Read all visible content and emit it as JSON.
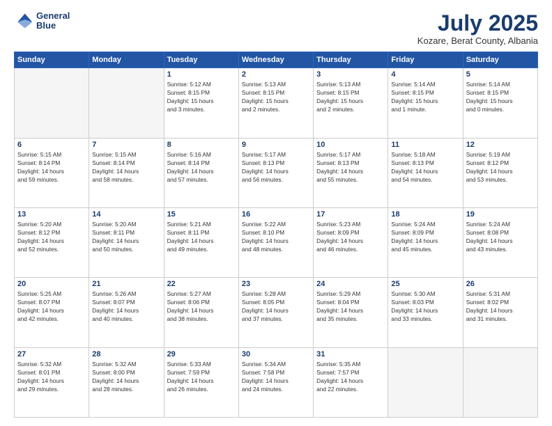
{
  "logo": {
    "line1": "General",
    "line2": "Blue"
  },
  "header": {
    "month": "July 2025",
    "location": "Kozare, Berat County, Albania"
  },
  "days_of_week": [
    "Sunday",
    "Monday",
    "Tuesday",
    "Wednesday",
    "Thursday",
    "Friday",
    "Saturday"
  ],
  "weeks": [
    [
      {
        "day": "",
        "info": ""
      },
      {
        "day": "",
        "info": ""
      },
      {
        "day": "1",
        "info": "Sunrise: 5:12 AM\nSunset: 8:15 PM\nDaylight: 15 hours\nand 3 minutes."
      },
      {
        "day": "2",
        "info": "Sunrise: 5:13 AM\nSunset: 8:15 PM\nDaylight: 15 hours\nand 2 minutes."
      },
      {
        "day": "3",
        "info": "Sunrise: 5:13 AM\nSunset: 8:15 PM\nDaylight: 15 hours\nand 2 minutes."
      },
      {
        "day": "4",
        "info": "Sunrise: 5:14 AM\nSunset: 8:15 PM\nDaylight: 15 hours\nand 1 minute."
      },
      {
        "day": "5",
        "info": "Sunrise: 5:14 AM\nSunset: 8:15 PM\nDaylight: 15 hours\nand 0 minutes."
      }
    ],
    [
      {
        "day": "6",
        "info": "Sunrise: 5:15 AM\nSunset: 8:14 PM\nDaylight: 14 hours\nand 59 minutes."
      },
      {
        "day": "7",
        "info": "Sunrise: 5:15 AM\nSunset: 8:14 PM\nDaylight: 14 hours\nand 58 minutes."
      },
      {
        "day": "8",
        "info": "Sunrise: 5:16 AM\nSunset: 8:14 PM\nDaylight: 14 hours\nand 57 minutes."
      },
      {
        "day": "9",
        "info": "Sunrise: 5:17 AM\nSunset: 8:13 PM\nDaylight: 14 hours\nand 56 minutes."
      },
      {
        "day": "10",
        "info": "Sunrise: 5:17 AM\nSunset: 8:13 PM\nDaylight: 14 hours\nand 55 minutes."
      },
      {
        "day": "11",
        "info": "Sunrise: 5:18 AM\nSunset: 8:13 PM\nDaylight: 14 hours\nand 54 minutes."
      },
      {
        "day": "12",
        "info": "Sunrise: 5:19 AM\nSunset: 8:12 PM\nDaylight: 14 hours\nand 53 minutes."
      }
    ],
    [
      {
        "day": "13",
        "info": "Sunrise: 5:20 AM\nSunset: 8:12 PM\nDaylight: 14 hours\nand 52 minutes."
      },
      {
        "day": "14",
        "info": "Sunrise: 5:20 AM\nSunset: 8:11 PM\nDaylight: 14 hours\nand 50 minutes."
      },
      {
        "day": "15",
        "info": "Sunrise: 5:21 AM\nSunset: 8:11 PM\nDaylight: 14 hours\nand 49 minutes."
      },
      {
        "day": "16",
        "info": "Sunrise: 5:22 AM\nSunset: 8:10 PM\nDaylight: 14 hours\nand 48 minutes."
      },
      {
        "day": "17",
        "info": "Sunrise: 5:23 AM\nSunset: 8:09 PM\nDaylight: 14 hours\nand 46 minutes."
      },
      {
        "day": "18",
        "info": "Sunrise: 5:24 AM\nSunset: 8:09 PM\nDaylight: 14 hours\nand 45 minutes."
      },
      {
        "day": "19",
        "info": "Sunrise: 5:24 AM\nSunset: 8:08 PM\nDaylight: 14 hours\nand 43 minutes."
      }
    ],
    [
      {
        "day": "20",
        "info": "Sunrise: 5:25 AM\nSunset: 8:07 PM\nDaylight: 14 hours\nand 42 minutes."
      },
      {
        "day": "21",
        "info": "Sunrise: 5:26 AM\nSunset: 8:07 PM\nDaylight: 14 hours\nand 40 minutes."
      },
      {
        "day": "22",
        "info": "Sunrise: 5:27 AM\nSunset: 8:06 PM\nDaylight: 14 hours\nand 38 minutes."
      },
      {
        "day": "23",
        "info": "Sunrise: 5:28 AM\nSunset: 8:05 PM\nDaylight: 14 hours\nand 37 minutes."
      },
      {
        "day": "24",
        "info": "Sunrise: 5:29 AM\nSunset: 8:04 PM\nDaylight: 14 hours\nand 35 minutes."
      },
      {
        "day": "25",
        "info": "Sunrise: 5:30 AM\nSunset: 8:03 PM\nDaylight: 14 hours\nand 33 minutes."
      },
      {
        "day": "26",
        "info": "Sunrise: 5:31 AM\nSunset: 8:02 PM\nDaylight: 14 hours\nand 31 minutes."
      }
    ],
    [
      {
        "day": "27",
        "info": "Sunrise: 5:32 AM\nSunset: 8:01 PM\nDaylight: 14 hours\nand 29 minutes."
      },
      {
        "day": "28",
        "info": "Sunrise: 5:32 AM\nSunset: 8:00 PM\nDaylight: 14 hours\nand 28 minutes."
      },
      {
        "day": "29",
        "info": "Sunrise: 5:33 AM\nSunset: 7:59 PM\nDaylight: 14 hours\nand 26 minutes."
      },
      {
        "day": "30",
        "info": "Sunrise: 5:34 AM\nSunset: 7:58 PM\nDaylight: 14 hours\nand 24 minutes."
      },
      {
        "day": "31",
        "info": "Sunrise: 5:35 AM\nSunset: 7:57 PM\nDaylight: 14 hours\nand 22 minutes."
      },
      {
        "day": "",
        "info": ""
      },
      {
        "day": "",
        "info": ""
      }
    ]
  ]
}
